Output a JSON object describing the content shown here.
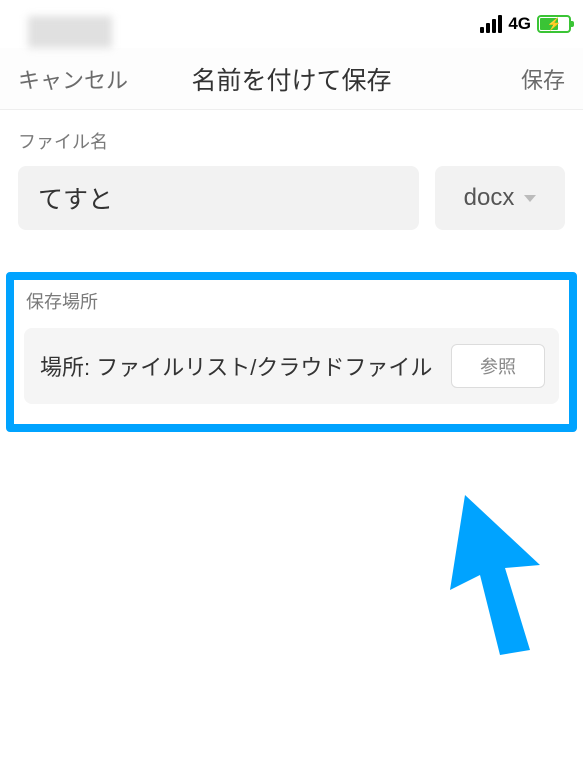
{
  "status": {
    "network": "4G"
  },
  "nav": {
    "cancel": "キャンセル",
    "title": "名前を付けて保存",
    "save": "保存"
  },
  "filename": {
    "label": "ファイル名",
    "value": "てすと",
    "ext": "docx"
  },
  "location": {
    "label": "保存場所",
    "path": "場所: ファイルリスト/クラウドファイル",
    "browse": "参照"
  },
  "colors": {
    "highlight": "#00a3ff",
    "battery": "#3ac435"
  }
}
